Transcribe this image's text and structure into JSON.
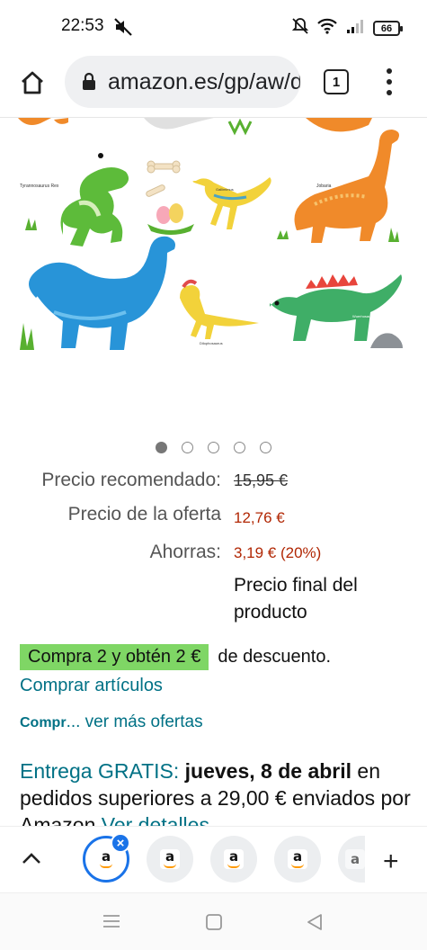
{
  "status_bar": {
    "time": "22:53",
    "battery": "66",
    "icons": [
      "mute-icon",
      "alarm-off-icon",
      "wifi-icon",
      "signal-icon",
      "battery-icon"
    ]
  },
  "browser": {
    "url": "amazon.es/gp/aw/d",
    "tab_count": "1"
  },
  "product_image": {
    "dinosaur_labels": [
      "Tyrannosaurus Rex",
      "Gallimimus",
      "Jobaria",
      "Diplodocus",
      "Dilophosaurus",
      "Wuerhosaurus"
    ],
    "carousel_total": 5,
    "carousel_active": 1
  },
  "price": {
    "recommended_label": "Precio recomendado:",
    "recommended_value": "15,95 €",
    "offer_label": "Precio de la oferta",
    "offer_value": "12,76 €",
    "savings_label": "Ahorras:",
    "savings_value": "3,19 € (20%)",
    "final_note": "Precio final del producto"
  },
  "promo": {
    "badge": "Compra 2 y obtén 2 €",
    "text": "de descuento.",
    "buy_items": "Comprar artículos",
    "more_prefix": "Compr",
    "more_link": "... ver más ofertas"
  },
  "delivery": {
    "free": "Entrega GRATIS:",
    "date": "jueves, 8 de abril",
    "condition": "en pedidos superiores a 29,00 €",
    "shipped": "enviados por Amazon",
    "details_link": "Ver detalles"
  },
  "tab_strip": {
    "tab_letter": "a",
    "close_symbol": "×",
    "add_symbol": "+"
  },
  "colors": {
    "link": "#007185",
    "price_red": "#b12704",
    "promo_green": "#7fd665",
    "chrome_blue": "#1a73e8"
  }
}
